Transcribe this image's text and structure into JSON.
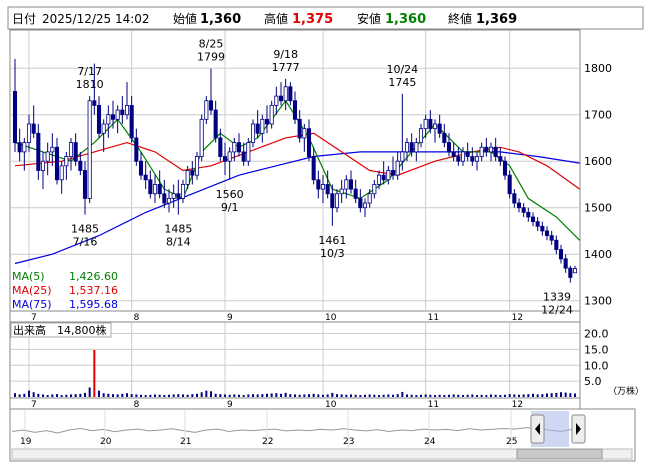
{
  "header": {
    "date_label": "日付",
    "datetime": "2025/12/25 14:02",
    "open_label": "始値",
    "open": "1,360",
    "high_label": "高値",
    "high": "1,375",
    "low_label": "安値",
    "low": "1,360",
    "close_label": "終値",
    "close": "1,369"
  },
  "colors": {
    "high": "#e00000",
    "low": "#008000",
    "candle": "#000080",
    "ma5": "#008000",
    "ma25": "#e00000",
    "ma75": "#0000e0",
    "volume": "#000080",
    "volume_spike": "#e00000",
    "grid": "#cccccc"
  },
  "legend": [
    {
      "name": "MA(5)",
      "value": "1,426.60"
    },
    {
      "name": "MA(25)",
      "value": "1,537.16"
    },
    {
      "name": "MA(75)",
      "value": "1,595.68"
    }
  ],
  "volume_panel": {
    "label": "出来高",
    "value": "14,800株",
    "unit": "（万株）",
    "ticks": [
      "20.0",
      "15.0",
      "10.0",
      "5.0"
    ]
  },
  "chart_data": {
    "type": "candlestick",
    "ylim": [
      1280,
      1880
    ],
    "y_ticks": [
      1800,
      1700,
      1600,
      1500,
      1400,
      1300
    ],
    "month_labels": [
      {
        "label": "7",
        "day": 3
      },
      {
        "label": "8",
        "day": 25
      },
      {
        "label": "9",
        "day": 45
      },
      {
        "label": "10",
        "day": 66
      },
      {
        "label": "11",
        "day": 88
      },
      {
        "label": "12",
        "day": 106
      }
    ],
    "annotations": [
      {
        "value": "1810",
        "date": "7/17",
        "day": 16,
        "pos": "above"
      },
      {
        "value": "1799",
        "date": "8/25",
        "day": 42,
        "pos": "above"
      },
      {
        "value": "1777",
        "date": "9/18",
        "day": 58,
        "pos": "above"
      },
      {
        "value": "1745",
        "date": "10/24",
        "day": 83,
        "pos": "above"
      },
      {
        "value": "1485",
        "date": "7/16",
        "day": 15,
        "pos": "below"
      },
      {
        "value": "1485",
        "date": "8/14",
        "day": 35,
        "pos": "below"
      },
      {
        "value": "1560",
        "date": "9/1",
        "day": 46,
        "pos": "below"
      },
      {
        "value": "1461",
        "date": "10/3",
        "day": 68,
        "pos": "below"
      },
      {
        "value": "1339",
        "date": "12/24",
        "day": 121,
        "pos": "below"
      }
    ],
    "candles": [
      [
        1750,
        1820,
        1620,
        1640
      ],
      [
        1640,
        1670,
        1600,
        1620
      ],
      [
        1620,
        1650,
        1580,
        1640
      ],
      [
        1640,
        1700,
        1620,
        1680
      ],
      [
        1680,
        1720,
        1650,
        1660
      ],
      [
        1660,
        1680,
        1560,
        1580
      ],
      [
        1580,
        1620,
        1540,
        1600
      ],
      [
        1600,
        1640,
        1570,
        1620
      ],
      [
        1620,
        1660,
        1590,
        1630
      ],
      [
        1630,
        1650,
        1550,
        1560
      ],
      [
        1560,
        1600,
        1530,
        1590
      ],
      [
        1590,
        1620,
        1560,
        1610
      ],
      [
        1610,
        1650,
        1580,
        1640
      ],
      [
        1640,
        1660,
        1590,
        1600
      ],
      [
        1600,
        1620,
        1570,
        1580
      ],
      [
        1580,
        1600,
        1485,
        1520
      ],
      [
        1520,
        1740,
        1510,
        1730
      ],
      [
        1730,
        1810,
        1700,
        1720
      ],
      [
        1720,
        1740,
        1650,
        1660
      ],
      [
        1660,
        1690,
        1620,
        1680
      ],
      [
        1680,
        1720,
        1650,
        1700
      ],
      [
        1700,
        1730,
        1670,
        1690
      ],
      [
        1690,
        1720,
        1660,
        1710
      ],
      [
        1710,
        1740,
        1680,
        1700
      ],
      [
        1700,
        1770,
        1690,
        1720
      ],
      [
        1720,
        1740,
        1640,
        1650
      ],
      [
        1650,
        1670,
        1590,
        1600
      ],
      [
        1600,
        1620,
        1560,
        1570
      ],
      [
        1570,
        1600,
        1540,
        1560
      ],
      [
        1560,
        1580,
        1520,
        1530
      ],
      [
        1530,
        1570,
        1510,
        1550
      ],
      [
        1550,
        1580,
        1520,
        1530
      ],
      [
        1530,
        1560,
        1500,
        1510
      ],
      [
        1510,
        1540,
        1490,
        1520
      ],
      [
        1520,
        1550,
        1500,
        1530
      ],
      [
        1530,
        1560,
        1485,
        1520
      ],
      [
        1520,
        1560,
        1510,
        1550
      ],
      [
        1550,
        1590,
        1540,
        1580
      ],
      [
        1580,
        1600,
        1550,
        1570
      ],
      [
        1570,
        1620,
        1560,
        1610
      ],
      [
        1610,
        1700,
        1600,
        1690
      ],
      [
        1690,
        1740,
        1680,
        1730
      ],
      [
        1730,
        1799,
        1700,
        1710
      ],
      [
        1710,
        1730,
        1640,
        1650
      ],
      [
        1650,
        1670,
        1600,
        1610
      ],
      [
        1610,
        1640,
        1570,
        1600
      ],
      [
        1600,
        1630,
        1560,
        1620
      ],
      [
        1620,
        1650,
        1600,
        1640
      ],
      [
        1640,
        1660,
        1610,
        1620
      ],
      [
        1620,
        1640,
        1590,
        1600
      ],
      [
        1600,
        1650,
        1590,
        1640
      ],
      [
        1640,
        1690,
        1630,
        1680
      ],
      [
        1680,
        1710,
        1650,
        1660
      ],
      [
        1660,
        1700,
        1640,
        1690
      ],
      [
        1690,
        1720,
        1660,
        1680
      ],
      [
        1680,
        1730,
        1670,
        1720
      ],
      [
        1720,
        1760,
        1700,
        1740
      ],
      [
        1740,
        1770,
        1720,
        1730
      ],
      [
        1730,
        1777,
        1710,
        1760
      ],
      [
        1760,
        1770,
        1720,
        1730
      ],
      [
        1730,
        1750,
        1680,
        1690
      ],
      [
        1690,
        1710,
        1640,
        1650
      ],
      [
        1650,
        1680,
        1620,
        1670
      ],
      [
        1670,
        1690,
        1600,
        1610
      ],
      [
        1610,
        1630,
        1550,
        1560
      ],
      [
        1560,
        1580,
        1520,
        1540
      ],
      [
        1540,
        1570,
        1510,
        1550
      ],
      [
        1550,
        1580,
        1520,
        1530
      ],
      [
        1530,
        1550,
        1461,
        1500
      ],
      [
        1500,
        1540,
        1490,
        1530
      ],
      [
        1530,
        1560,
        1510,
        1540
      ],
      [
        1540,
        1570,
        1520,
        1560
      ],
      [
        1560,
        1580,
        1530,
        1540
      ],
      [
        1540,
        1560,
        1510,
        1520
      ],
      [
        1520,
        1540,
        1490,
        1500
      ],
      [
        1500,
        1520,
        1480,
        1510
      ],
      [
        1510,
        1540,
        1500,
        1530
      ],
      [
        1530,
        1560,
        1520,
        1550
      ],
      [
        1550,
        1580,
        1540,
        1570
      ],
      [
        1570,
        1600,
        1550,
        1560
      ],
      [
        1560,
        1590,
        1550,
        1580
      ],
      [
        1580,
        1610,
        1560,
        1570
      ],
      [
        1570,
        1620,
        1560,
        1600
      ],
      [
        1600,
        1745,
        1580,
        1620
      ],
      [
        1620,
        1650,
        1600,
        1640
      ],
      [
        1640,
        1660,
        1610,
        1620
      ],
      [
        1620,
        1650,
        1600,
        1640
      ],
      [
        1640,
        1680,
        1630,
        1670
      ],
      [
        1670,
        1700,
        1650,
        1690
      ],
      [
        1690,
        1710,
        1660,
        1670
      ],
      [
        1670,
        1690,
        1640,
        1680
      ],
      [
        1680,
        1700,
        1650,
        1660
      ],
      [
        1660,
        1680,
        1630,
        1640
      ],
      [
        1640,
        1660,
        1610,
        1620
      ],
      [
        1620,
        1640,
        1600,
        1610
      ],
      [
        1610,
        1630,
        1590,
        1600
      ],
      [
        1600,
        1630,
        1590,
        1620
      ],
      [
        1620,
        1640,
        1600,
        1610
      ],
      [
        1610,
        1630,
        1590,
        1600
      ],
      [
        1600,
        1620,
        1580,
        1610
      ],
      [
        1610,
        1640,
        1600,
        1630
      ],
      [
        1630,
        1650,
        1610,
        1620
      ],
      [
        1620,
        1640,
        1600,
        1630
      ],
      [
        1630,
        1650,
        1600,
        1610
      ],
      [
        1610,
        1630,
        1590,
        1600
      ],
      [
        1600,
        1610,
        1560,
        1570
      ],
      [
        1570,
        1580,
        1520,
        1530
      ],
      [
        1530,
        1540,
        1500,
        1510
      ],
      [
        1510,
        1520,
        1490,
        1500
      ],
      [
        1500,
        1510,
        1480,
        1490
      ],
      [
        1490,
        1500,
        1470,
        1480
      ],
      [
        1480,
        1490,
        1460,
        1470
      ],
      [
        1470,
        1480,
        1450,
        1460
      ],
      [
        1460,
        1470,
        1440,
        1450
      ],
      [
        1450,
        1460,
        1430,
        1440
      ],
      [
        1440,
        1450,
        1420,
        1430
      ],
      [
        1430,
        1440,
        1400,
        1410
      ],
      [
        1410,
        1420,
        1380,
        1390
      ],
      [
        1390,
        1400,
        1360,
        1370
      ],
      [
        1370,
        1375,
        1339,
        1350
      ],
      [
        1360,
        1375,
        1360,
        1369
      ]
    ],
    "volume": [
      1.2,
      0.8,
      1.0,
      2.0,
      1.5,
      1.0,
      0.8,
      0.6,
      0.8,
      0.9,
      0.6,
      0.7,
      0.8,
      0.9,
      1.0,
      1.3,
      3.0,
      14.8,
      2.0,
      1.2,
      1.0,
      0.9,
      0.8,
      1.0,
      1.2,
      0.9,
      0.8,
      0.7,
      0.6,
      0.7,
      0.8,
      0.7,
      0.6,
      0.7,
      0.8,
      0.9,
      0.8,
      0.7,
      0.9,
      1.0,
      1.5,
      2.0,
      1.8,
      1.0,
      0.9,
      0.8,
      0.7,
      0.8,
      0.7,
      0.6,
      0.8,
      0.9,
      0.8,
      0.9,
      1.0,
      1.1,
      1.2,
      1.0,
      1.3,
      0.9,
      0.8,
      0.7,
      0.8,
      0.9,
      1.0,
      0.8,
      0.7,
      0.8,
      1.3,
      0.9,
      0.8,
      0.7,
      0.8,
      0.7,
      0.6,
      0.7,
      0.8,
      0.7,
      0.6,
      0.7,
      0.8,
      0.7,
      0.9,
      1.6,
      0.8,
      0.7,
      0.6,
      0.7,
      0.8,
      0.7,
      0.6,
      0.7,
      0.6,
      0.7,
      0.8,
      0.7,
      0.6,
      0.7,
      0.8,
      0.6,
      0.7,
      0.6,
      0.8,
      0.7,
      0.6,
      0.7,
      0.9,
      0.8,
      0.7,
      0.8,
      0.9,
      1.0,
      0.8,
      0.9,
      1.1,
      1.2,
      1.3,
      1.5,
      1.4,
      1.2,
      1.1
    ],
    "ma5": [
      [
        0,
        1640
      ],
      [
        6,
        1620
      ],
      [
        12,
        1600
      ],
      [
        17,
        1640
      ],
      [
        22,
        1690
      ],
      [
        27,
        1620
      ],
      [
        32,
        1540
      ],
      [
        36,
        1520
      ],
      [
        40,
        1620
      ],
      [
        44,
        1660
      ],
      [
        48,
        1630
      ],
      [
        52,
        1650
      ],
      [
        58,
        1730
      ],
      [
        63,
        1650
      ],
      [
        68,
        1540
      ],
      [
        74,
        1520
      ],
      [
        80,
        1560
      ],
      [
        85,
        1620
      ],
      [
        90,
        1680
      ],
      [
        96,
        1620
      ],
      [
        102,
        1620
      ],
      [
        106,
        1590
      ],
      [
        110,
        1520
      ],
      [
        116,
        1480
      ],
      [
        121,
        1430
      ]
    ],
    "ma25": [
      [
        0,
        1590
      ],
      [
        10,
        1600
      ],
      [
        17,
        1620
      ],
      [
        24,
        1640
      ],
      [
        30,
        1620
      ],
      [
        36,
        1580
      ],
      [
        42,
        1590
      ],
      [
        50,
        1620
      ],
      [
        58,
        1650
      ],
      [
        64,
        1660
      ],
      [
        70,
        1620
      ],
      [
        76,
        1580
      ],
      [
        82,
        1570
      ],
      [
        90,
        1600
      ],
      [
        98,
        1620
      ],
      [
        104,
        1630
      ],
      [
        108,
        1620
      ],
      [
        114,
        1590
      ],
      [
        121,
        1540
      ]
    ],
    "ma75": [
      [
        0,
        1380
      ],
      [
        8,
        1400
      ],
      [
        18,
        1440
      ],
      [
        28,
        1490
      ],
      [
        38,
        1530
      ],
      [
        48,
        1570
      ],
      [
        56,
        1590
      ],
      [
        64,
        1610
      ],
      [
        74,
        1620
      ],
      [
        84,
        1620
      ],
      [
        94,
        1620
      ],
      [
        104,
        1620
      ],
      [
        112,
        1610
      ],
      [
        121,
        1596
      ]
    ],
    "overview_labels": [
      {
        "label": "19",
        "x": 20
      },
      {
        "label": "20",
        "x": 100
      },
      {
        "label": "21",
        "x": 180
      },
      {
        "label": "22",
        "x": 262
      },
      {
        "label": "23",
        "x": 343
      },
      {
        "label": "24",
        "x": 424
      },
      {
        "label": "25",
        "x": 506
      }
    ]
  }
}
